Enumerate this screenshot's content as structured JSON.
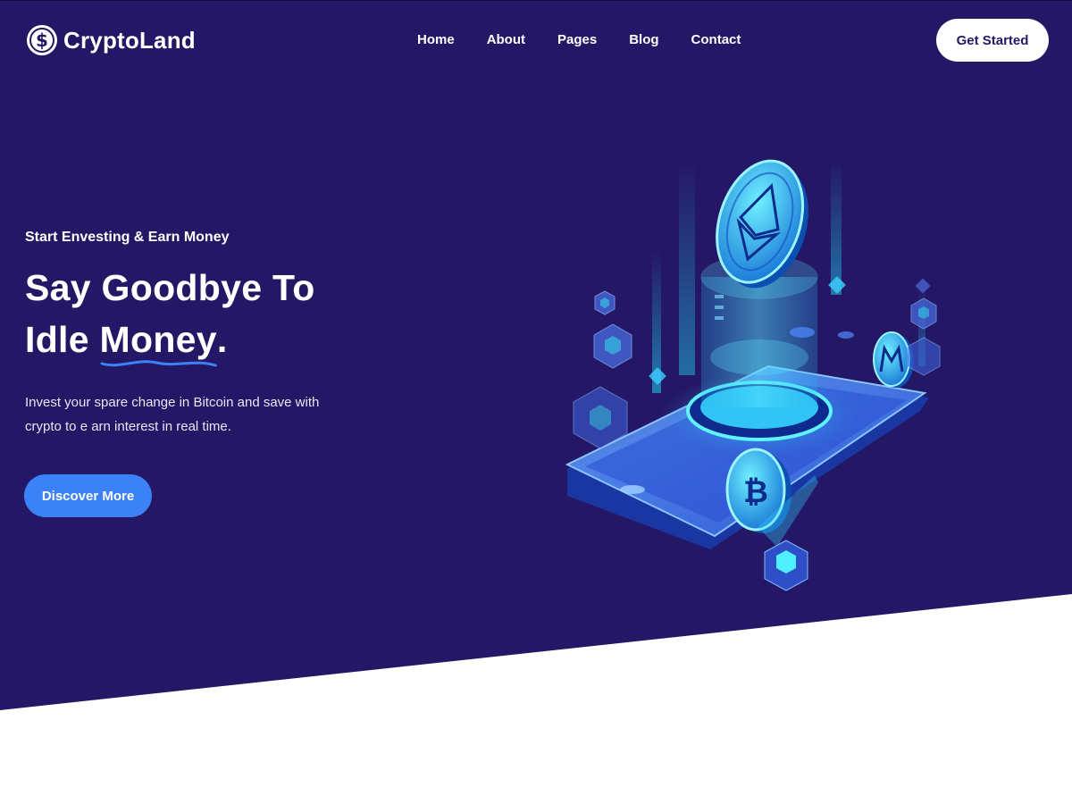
{
  "brand": {
    "name": "CryptoLand",
    "logo_icon": "dollar-coin-icon"
  },
  "nav": {
    "items": [
      {
        "label": "Home"
      },
      {
        "label": "About"
      },
      {
        "label": "Pages"
      },
      {
        "label": "Blog"
      },
      {
        "label": "Contact"
      }
    ],
    "cta_label": "Get Started"
  },
  "hero": {
    "eyebrow": "Start Envesting & Earn Money",
    "headline_line1": "Say Goodbye To",
    "headline_line2_prefix": "Idle ",
    "headline_highlight": "Money",
    "headline_suffix": ".",
    "description": "Invest your spare change in Bitcoin and save with crypto to e arn interest in real time.",
    "button_label": "Discover More",
    "illustration": "isometric-crypto-phone-illustration"
  },
  "colors": {
    "hero_background": "#241766",
    "primary_button": "#3b82f6",
    "accent_cyan": "#22d3ee",
    "page_background": "#ffffff"
  }
}
